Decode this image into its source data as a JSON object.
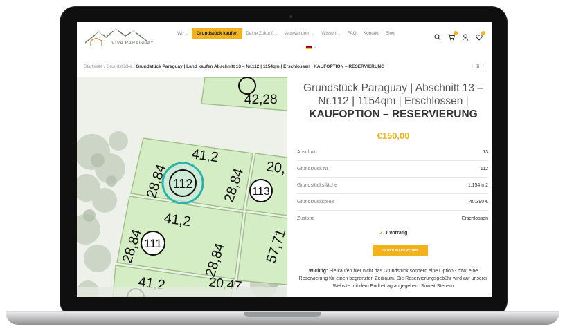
{
  "header": {
    "logo_text": "VIVA PARAGUAY",
    "nav": [
      {
        "label": "Wir",
        "caret": true,
        "active": false
      },
      {
        "label": "Grundstück kaufen",
        "caret": false,
        "active": true
      },
      {
        "label": "Deine Zukunft",
        "caret": true,
        "active": false
      },
      {
        "label": "Auswandern",
        "caret": true,
        "active": false
      },
      {
        "label": "Wissen",
        "caret": true,
        "active": false
      },
      {
        "label": "FAQ",
        "caret": false,
        "active": false
      },
      {
        "label": "Kontakt",
        "caret": false,
        "active": false
      },
      {
        "label": "Blog",
        "caret": false,
        "active": false
      }
    ],
    "icons": [
      "search-icon",
      "cart-icon",
      "account-icon",
      "wishlist-icon"
    ],
    "colors": {
      "accent": "#f2b21d"
    }
  },
  "breadcrumb": {
    "items": [
      "Startseite",
      "Grundstücke"
    ],
    "separator": "/",
    "current": "Grundstück Paraguay | Land kaufen Abschnitt 13 – Nr.112 | 1154qm | Erschlossen | KAUFOPTION – RESERVIERUNG",
    "nav": {
      "prev": "‹",
      "grid": "⊞",
      "next": "›"
    }
  },
  "gallery": {
    "plots": [
      "112",
      "113",
      "111"
    ],
    "dimensions": [
      "42,28",
      "41,2",
      "28,84",
      "20,",
      "28,84",
      "41,2",
      "28,84",
      "57,71",
      "28,84",
      "41,2",
      "20,47"
    ]
  },
  "product": {
    "title_line1": "Grundstück Paraguay | Abschnitt 13 –",
    "title_line2": "Nr.112 | 1154qm | Erschlossen |",
    "title_line3": "KAUFOPTION – RESERVIERUNG",
    "price": "€150,00",
    "specs": [
      {
        "label": "Abschnitt",
        "value": "13"
      },
      {
        "label": "Grundstück Nr",
        "value": "112"
      },
      {
        "label": "Grundstücksfläche",
        "value": "1.154 m2"
      },
      {
        "label": "Grundstückspreis",
        "value": "40.390 €"
      },
      {
        "label": "Zustand",
        "value": "Erschlossen"
      }
    ],
    "stock": "1 vorrätig",
    "cart_button": "IN DEN WARENKORB",
    "note_bold": "Wichtig:",
    "note_text": "Sie kaufen hier nicht das Grundstück sondern eine Option - bzw. eine Reservierung für einen begrenzten Zeitraum. Die Reservierungsgebühr wird auf unserer Website mit dem Endbetrag angegeben. Soweit Steuern"
  }
}
